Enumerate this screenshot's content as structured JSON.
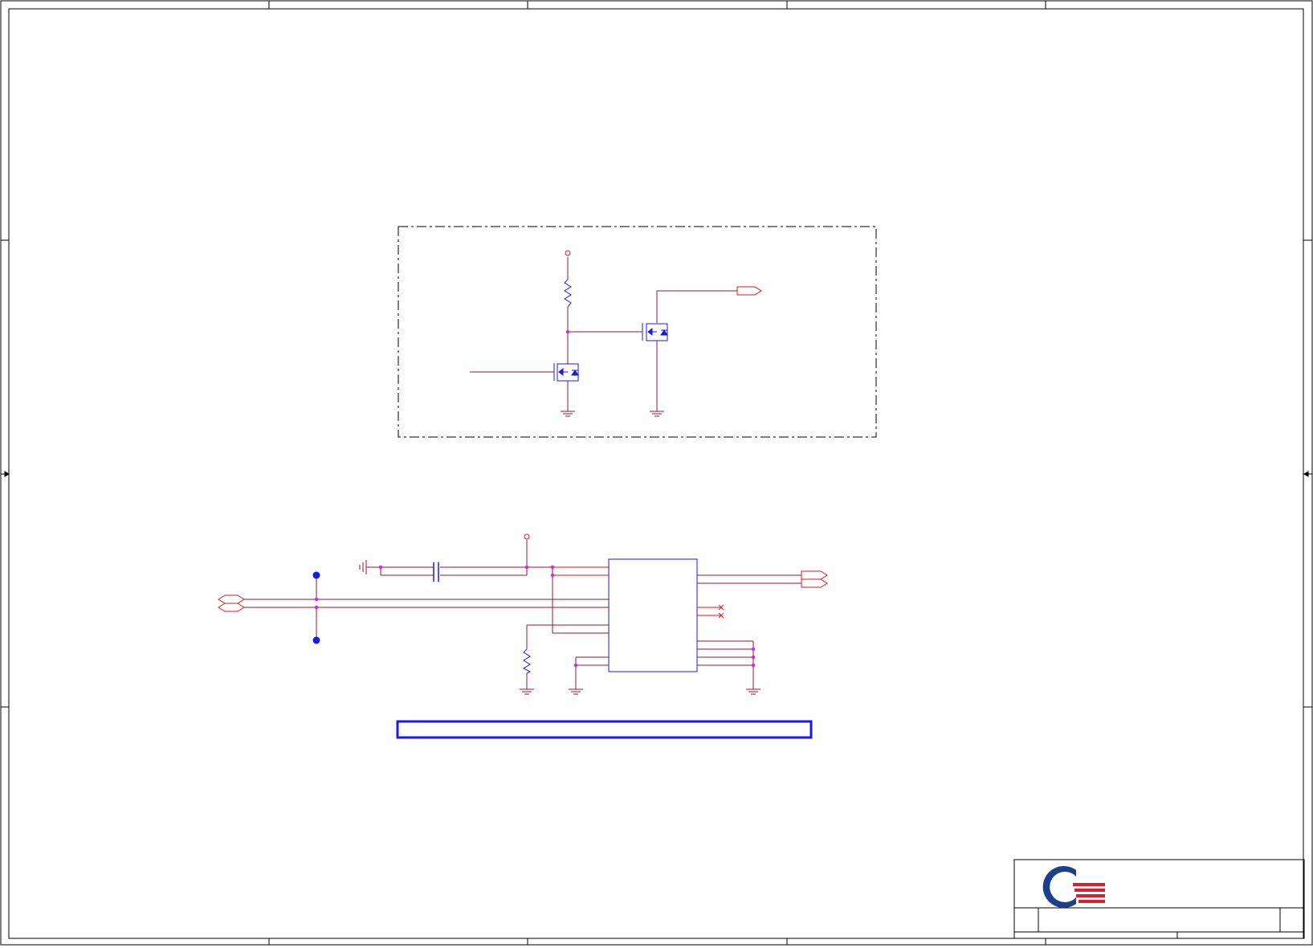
{
  "sheet": {
    "title": "",
    "border_color": "#000000",
    "wire_color": "#8B1A3A",
    "pin_color": "#E0161B",
    "symbol_color": "#1A1AE6",
    "junction_color": "#E020E0",
    "port_color": "#E0161B",
    "note_box_text": ""
  },
  "title_block": {
    "logo": "quanta-logo",
    "logo_colors": {
      "ring": "#1C3F8C",
      "stripes": "#D8202F"
    }
  }
}
